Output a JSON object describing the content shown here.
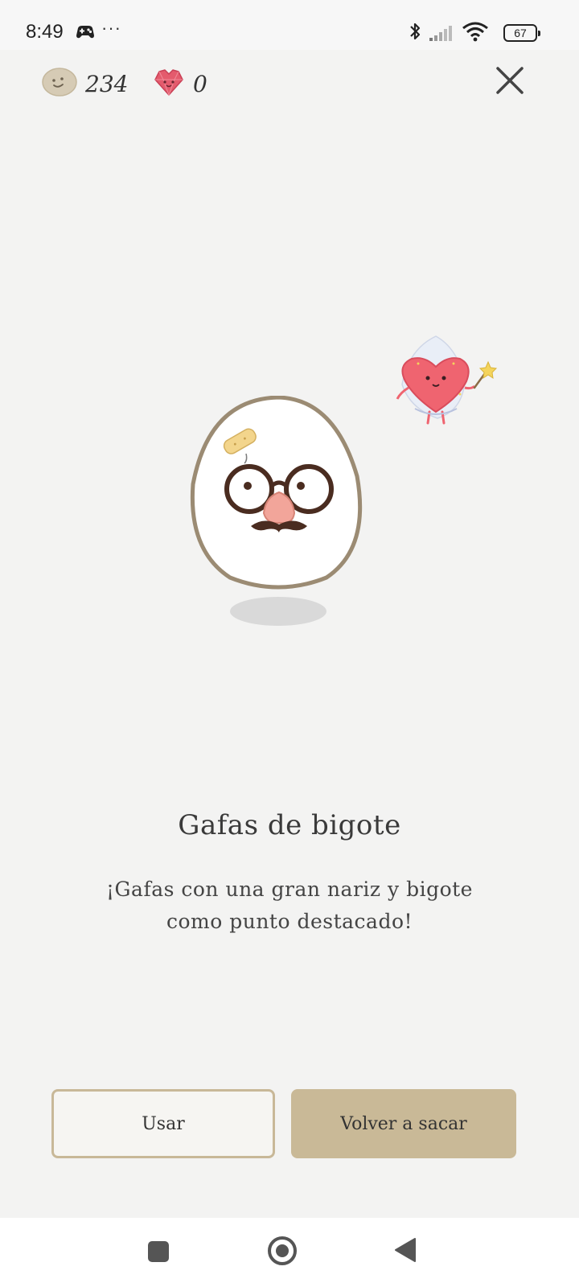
{
  "status_bar": {
    "time": "8:49",
    "dots": "···",
    "battery": "67",
    "icons": [
      "game-controller-icon",
      "bluetooth-icon",
      "signal-icon",
      "wifi-icon",
      "battery-icon"
    ]
  },
  "header": {
    "coins": "234",
    "gems": "0",
    "icons": [
      "coin-icon",
      "gem-heart-icon",
      "close-icon"
    ]
  },
  "item": {
    "title": "Gafas de bigote",
    "description": "¡Gafas con una gran nariz y bigote como punto destacado!"
  },
  "actions": {
    "use_label": "Usar",
    "redraw_label": "Volver a sacar"
  },
  "nav": {
    "icons": [
      "recents-square-icon",
      "home-circle-icon",
      "back-triangle-icon"
    ]
  },
  "colors": {
    "background": "#f3f3f2",
    "accent": "#c9b997",
    "egg_outline": "#9b8b73",
    "gem": "#e45b6d"
  }
}
